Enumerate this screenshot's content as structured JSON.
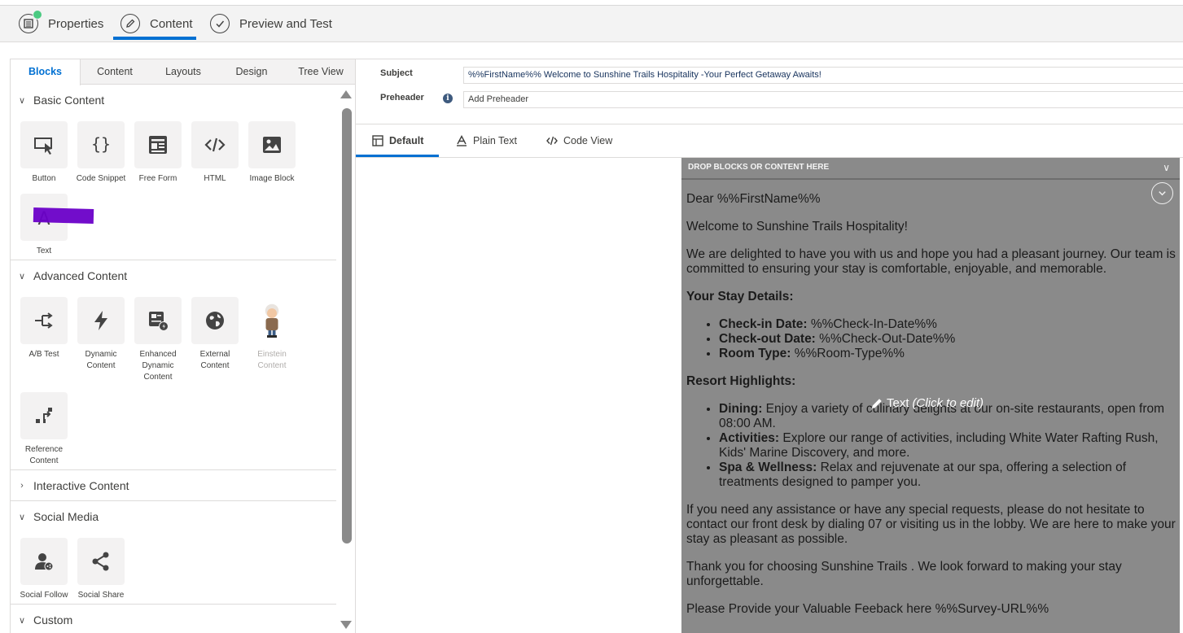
{
  "wizard": {
    "steps": [
      {
        "label": "Properties",
        "state": "complete"
      },
      {
        "label": "Content",
        "state": "active"
      },
      {
        "label": "Preview and Test",
        "state": "pending"
      }
    ]
  },
  "left_panel": {
    "tabs": [
      "Blocks",
      "Content",
      "Layouts",
      "Design",
      "Tree View"
    ],
    "active_tab": "Blocks",
    "sections": [
      {
        "title": "Basic Content",
        "expanded": true,
        "blocks": [
          "Button",
          "Code Snippet",
          "Free Form",
          "HTML",
          "Image Block",
          "Text"
        ]
      },
      {
        "title": "Advanced Content",
        "expanded": true,
        "blocks": [
          "A/B Test",
          "Dynamic Content",
          "Enhanced Dynamic Content",
          "External Content",
          "Einstein Content",
          "Reference Content"
        ]
      },
      {
        "title": "Interactive Content",
        "expanded": false,
        "blocks": []
      },
      {
        "title": "Social Media",
        "expanded": true,
        "blocks": [
          "Social Follow",
          "Social Share"
        ]
      },
      {
        "title": "Custom",
        "expanded": true,
        "blocks": []
      }
    ]
  },
  "header_fields": {
    "subject_label": "Subject",
    "subject_value": "%%FirstName%% Welcome to Sunshine Trails Hospitality -Your Perfect Getaway Awaits!",
    "preheader_label": "Preheader",
    "preheader_placeholder": "Add Preheader"
  },
  "view_tabs": [
    "Default",
    "Plain Text",
    "Code View"
  ],
  "active_view_tab": "Default",
  "canvas": {
    "drop_header": "DROP BLOCKS OR CONTENT HERE",
    "edit_badge": {
      "label": "Text",
      "hint": "(Click to edit)"
    },
    "greeting": "Dear %%FirstName%%",
    "welcome": "Welcome to Sunshine Trails Hospitality!",
    "intro": "We are delighted to have you with us and hope you had a pleasant journey. Our team is committed to ensuring your stay is comfortable, enjoyable, and memorable.",
    "stay_heading": "Your Stay Details:",
    "stay_items": [
      {
        "label": "Check-in Date:",
        "value": " %%Check-In-Date%%"
      },
      {
        "label": "Check-out Date:",
        "value": " %%Check-Out-Date%%"
      },
      {
        "label": "Room Type:",
        "value": " %%Room-Type%%"
      }
    ],
    "highlights_heading": "Resort Highlights:",
    "highlight_items": [
      {
        "label": "Dining:",
        "value": " Enjoy a variety of culinary delights at our on-site restaurants, open from 08:00 AM."
      },
      {
        "label": "Activities:",
        "value": " Explore our range of activities, including White Water Rafting Rush, Kids' Marine Discovery, and more."
      },
      {
        "label": "Spa & Wellness:",
        "value": " Relax and rejuvenate at our spa, offering a selection of treatments designed to pamper you."
      }
    ],
    "assistance": "If you need any assistance or have any special requests, please do not hesitate to contact our front desk by dialing 07 or visiting us in the lobby. We are here to make your stay as pleasant as possible.",
    "thanks": "Thank you for choosing Sunshine Trails . We look forward to making your stay unforgettable.",
    "feedback": "Please Provide your Valuable Feeback here %%Survey-URL%%"
  },
  "colors": {
    "accent": "#0070d2",
    "complete": "#4bca81",
    "canvas_bg": "#8a8a8a",
    "text_redaction": "#6a00c8"
  },
  "icons": [
    "properties-icon",
    "pencil-icon",
    "check-icon",
    "button-block-icon",
    "code-braces-icon",
    "free-form-icon",
    "html-code-icon",
    "image-icon",
    "text-block-icon",
    "ab-test-icon",
    "lightning-icon",
    "enhanced-dynamic-icon",
    "globe-icon",
    "einstein-icon",
    "reference-icon",
    "social-follow-icon",
    "share-icon",
    "info-icon"
  ]
}
